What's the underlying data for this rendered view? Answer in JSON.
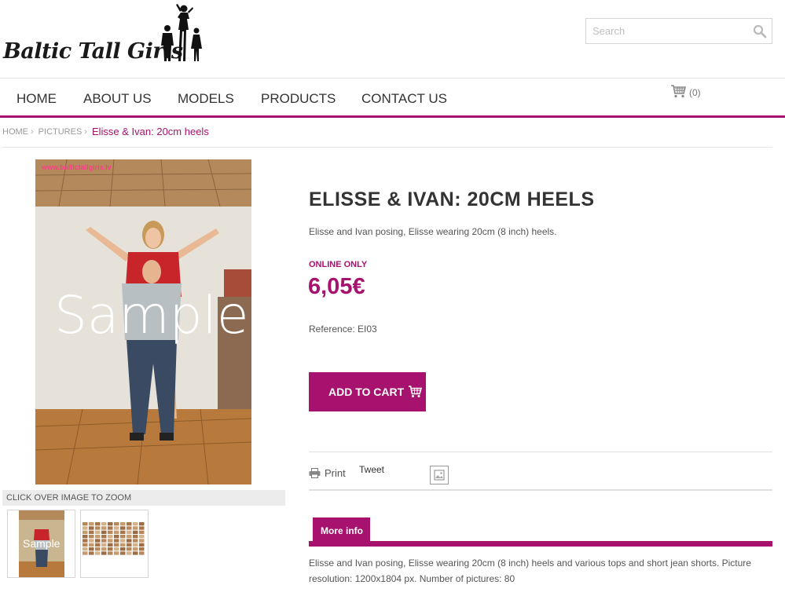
{
  "brand": {
    "logo_text": "Baltic Tall Girls",
    "accent": "#a6126e"
  },
  "search": {
    "placeholder": "Search",
    "icon": "search-icon"
  },
  "nav": {
    "items": [
      {
        "label": "HOME"
      },
      {
        "label": "ABOUT US"
      },
      {
        "label": "MODELS"
      },
      {
        "label": "PRODUCTS"
      },
      {
        "label": "CONTACT US"
      }
    ]
  },
  "cart": {
    "icon": "cart-icon",
    "count": "(0)"
  },
  "breadcrumb": {
    "items": [
      {
        "label": "HOME"
      },
      {
        "label": "PICTURES"
      }
    ],
    "current": "Elisse & Ivan: 20cm heels"
  },
  "gallery": {
    "watermark_url": "www.baltictallgirls.lv",
    "sample_overlay": "Sample",
    "zoom_hint": "CLICK OVER IMAGE TO ZOOM",
    "thumb_sample_overlay": "Sample"
  },
  "product": {
    "title": "ELISSE & IVAN: 20CM HEELS",
    "short_description": "Elisse and Ivan posing, Elisse wearing 20cm (8 inch) heels.",
    "online_only": "ONLINE ONLY",
    "price": "6,05€",
    "reference": "Reference: EI03",
    "add_to_cart": "ADD TO CART"
  },
  "share": {
    "print_label": "Print",
    "tweet_label": "Tweet"
  },
  "tabs": {
    "more_info": "More info"
  },
  "more_info_text": "Elisse and Ivan posing, Elisse wearing 20cm (8 inch) heels and various tops and short jean shorts. Picture resolution: 1200x1804 px. Number of pictures: 80"
}
